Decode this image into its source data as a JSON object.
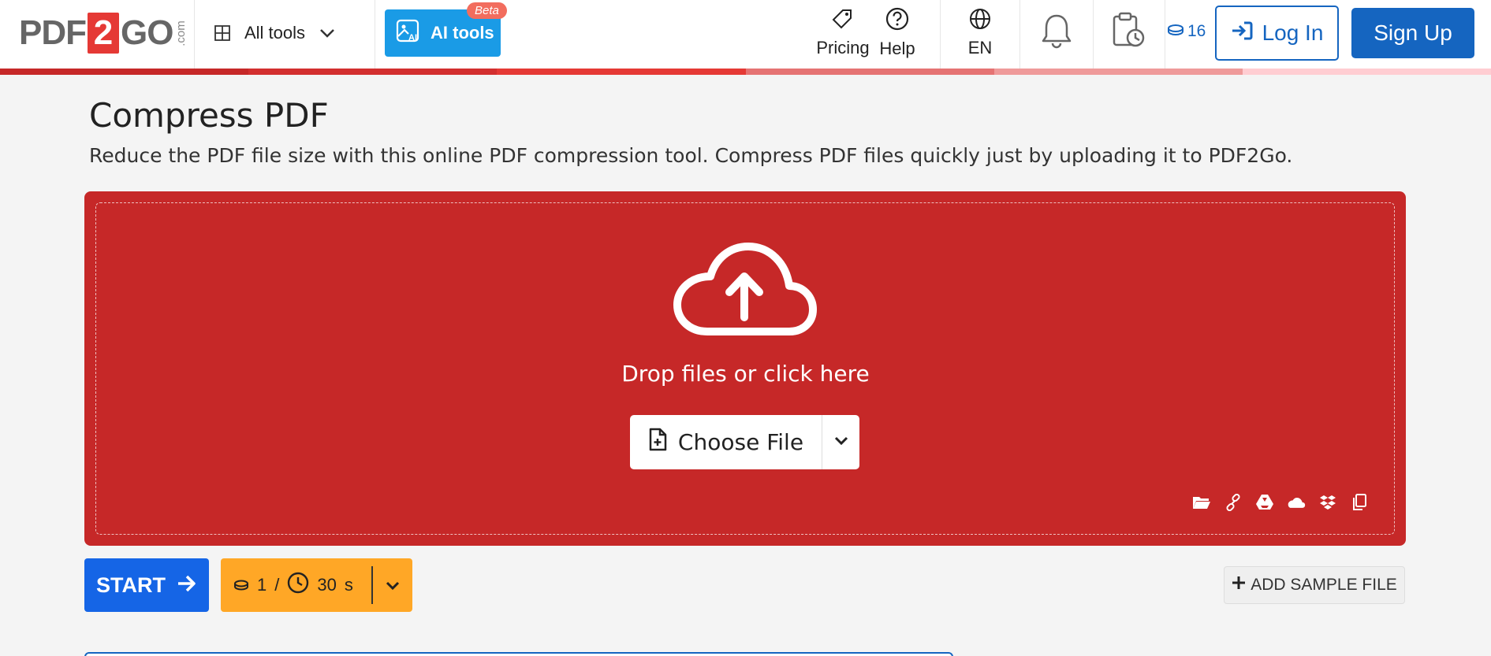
{
  "header": {
    "logo": {
      "left": "PDF",
      "number": "2",
      "right": "GO",
      "suffix": ".com"
    },
    "all_tools_label": "All tools",
    "ai_tools_label": "AI tools",
    "ai_tools_badge": "Beta",
    "pricing_label": "Pricing",
    "help_label": "Help",
    "language_label": "EN",
    "credits_count": "16",
    "login_label": "Log In",
    "signup_label": "Sign Up",
    "stripe_colors": [
      "#c62828",
      "#d32f2f",
      "#e53935",
      "#e57373",
      "#ef9a9a",
      "#ffcdd2"
    ]
  },
  "main": {
    "title": "Compress PDF",
    "description": "Reduce the PDF file size with this online PDF compression tool. Compress PDF files quickly just by uploading it to PDF2Go.",
    "dropzone": {
      "text": "Drop files or click here",
      "choose_file_label": "Choose File",
      "accent_color": "#c62828",
      "source_icons": [
        "folder-icon",
        "link-icon",
        "google-drive-icon",
        "onedrive-icon",
        "dropbox-icon",
        "clipboard-icon"
      ]
    },
    "start_label": "START",
    "cost": {
      "credits": "1",
      "separator": "/",
      "time": "30",
      "unit": "s"
    },
    "add_sample_label": "ADD SAMPLE FILE"
  }
}
